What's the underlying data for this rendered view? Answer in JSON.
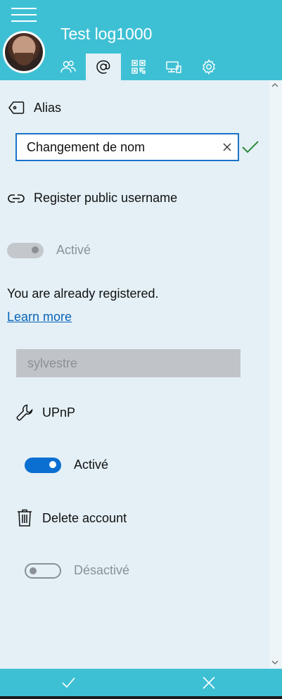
{
  "header": {
    "account_name": "Test log1000",
    "tabs": [
      {
        "name": "contacts",
        "icon": "contacts-icon"
      },
      {
        "name": "alias",
        "icon": "at-icon"
      },
      {
        "name": "qr",
        "icon": "qr-code-icon"
      },
      {
        "name": "devices",
        "icon": "devices-icon"
      },
      {
        "name": "settings",
        "icon": "gear-icon"
      }
    ],
    "active_tab": "alias"
  },
  "alias": {
    "label": "Alias",
    "input_value": "Changement de nom"
  },
  "register": {
    "label": "Register public username",
    "toggle_label": "Activé",
    "toggle_on": true,
    "status_text": "You are already registered.",
    "learn_more": "Learn more",
    "username_value": "sylvestre"
  },
  "upnp": {
    "label": "UPnP",
    "toggle_label": "Activé",
    "toggle_on": true
  },
  "delete_account": {
    "label": "Delete account",
    "toggle_label": "Désactivé",
    "toggle_on": false
  },
  "colors": {
    "header": "#3ec0d4",
    "accent": "#0a6fd1",
    "background": "#e4f0f6",
    "confirm": "#2e8b3a"
  }
}
